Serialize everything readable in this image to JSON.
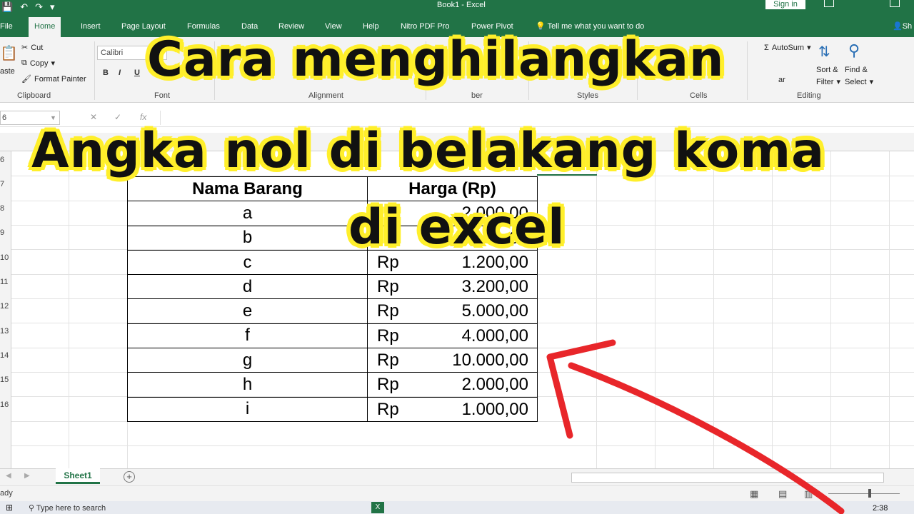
{
  "window": {
    "title": "Book1 - Excel",
    "sign_in": "Sign in"
  },
  "tabs": [
    {
      "label": "File"
    },
    {
      "label": "Home"
    },
    {
      "label": "Insert"
    },
    {
      "label": "Page Layout"
    },
    {
      "label": "Formulas"
    },
    {
      "label": "Data"
    },
    {
      "label": "Review"
    },
    {
      "label": "View"
    },
    {
      "label": "Help"
    },
    {
      "label": "Nitro PDF Pro"
    },
    {
      "label": "Power Pivot"
    }
  ],
  "tell_me": "Tell me what you want to do",
  "share_label": "Sh",
  "ribbon": {
    "paste": "aste",
    "cut": "Cut",
    "copy": "Copy",
    "format_painter": "Format Painter",
    "clipboard": "Clipboard",
    "font_name": "Calibri",
    "bold": "B",
    "italic": "I",
    "underline": "U",
    "font": "Font",
    "alignment": "Alignment",
    "number": "ber",
    "styles": "Styles",
    "cells": "Cells",
    "autosum": "AutoSum",
    "sort_filter_1": "Sort &",
    "sort_filter_2": "Filter",
    "find_select_1": "Find &",
    "find_select_2": "Select",
    "editing": "Editing",
    "fill_partial": "ar"
  },
  "formula_bar": {
    "name_box": "6",
    "cancel": "✕",
    "enter": "✓",
    "fx": "fx"
  },
  "row_numbers": [
    "6",
    "7",
    "8",
    "9",
    "10",
    "11",
    "12",
    "13",
    "14",
    "15",
    "16",
    "",
    ""
  ],
  "table": {
    "headers": [
      "Nama Barang",
      "Harga (Rp)"
    ],
    "rows": [
      {
        "name": "a",
        "currency": "",
        "amount": "2.000,00"
      },
      {
        "name": "b",
        "currency": "",
        "amount": "00"
      },
      {
        "name": "c",
        "currency": "Rp",
        "amount": "1.200,00"
      },
      {
        "name": "d",
        "currency": "Rp",
        "amount": "3.200,00"
      },
      {
        "name": "e",
        "currency": "Rp",
        "amount": "5.000,00"
      },
      {
        "name": "f",
        "currency": "Rp",
        "amount": "4.000,00"
      },
      {
        "name": "g",
        "currency": "Rp",
        "amount": "10.000,00"
      },
      {
        "name": "h",
        "currency": "Rp",
        "amount": "2.000,00"
      },
      {
        "name": "i",
        "currency": "Rp",
        "amount": "1.000,00"
      }
    ]
  },
  "sheets": [
    {
      "label": "Sheet1"
    }
  ],
  "add_sheet": "+",
  "status": "ady",
  "taskbar": {
    "search": "Type here to search",
    "clock": "2:38"
  },
  "overlay": {
    "line1": "Cara menghilangkan",
    "line2": "Angka nol di belakang koma",
    "line3": "di excel"
  },
  "colors": {
    "excel_green": "#217346",
    "overlay_yellow": "#ffef2b",
    "arrow_red": "#e8262a"
  }
}
